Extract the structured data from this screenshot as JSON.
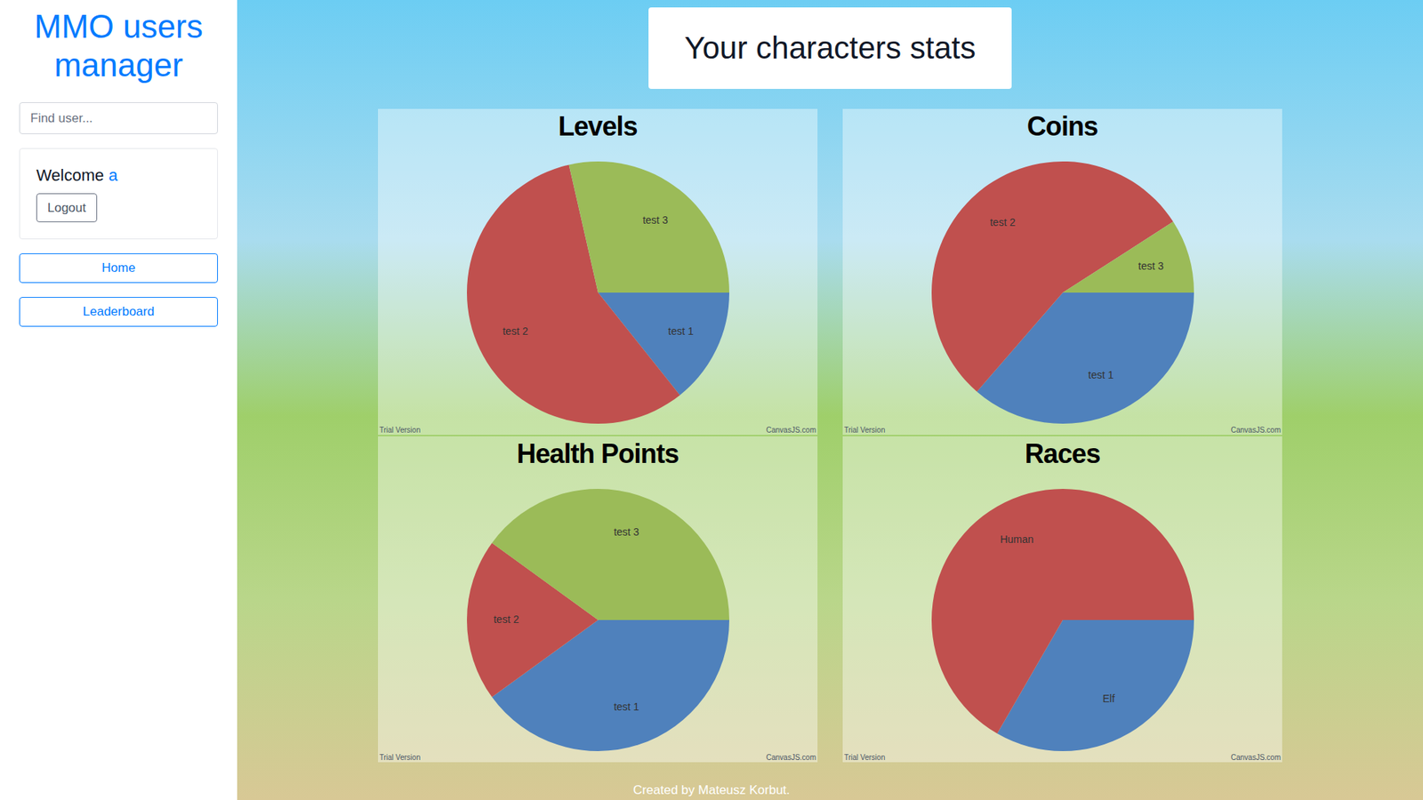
{
  "sidebar": {
    "title": "MMO users manager",
    "search": {
      "placeholder": "Find user..."
    },
    "welcome": {
      "label": "Welcome",
      "user": "a",
      "logout": "Logout"
    },
    "nav": [
      {
        "label": "Home"
      },
      {
        "label": "Leaderboard"
      }
    ]
  },
  "header": {
    "title": "Your characters stats"
  },
  "charts": [
    {
      "title": "Levels",
      "watermark": "Trial Version",
      "credit": "CanvasJS.com",
      "slices": [
        {
          "label": "test 1",
          "value": 5,
          "color": "#4f81bc"
        },
        {
          "label": "test 2",
          "value": 20,
          "color": "#c0504e"
        },
        {
          "label": "test 3",
          "value": 10,
          "color": "#9bbb58"
        }
      ]
    },
    {
      "title": "Coins",
      "watermark": "Trial Version",
      "credit": "CanvasJS.com",
      "slices": [
        {
          "label": "test 1",
          "value": 400,
          "color": "#4f81bc"
        },
        {
          "label": "test 2",
          "value": 600,
          "color": "#c0504e"
        },
        {
          "label": "test 3",
          "value": 100,
          "color": "#9bbb58"
        }
      ]
    },
    {
      "title": "Health Points",
      "watermark": "Trial Version",
      "credit": "CanvasJS.com",
      "slices": [
        {
          "label": "test 1",
          "value": 100,
          "color": "#4f81bc"
        },
        {
          "label": "test 2",
          "value": 50,
          "color": "#c0504e"
        },
        {
          "label": "test 3",
          "value": 100,
          "color": "#9bbb58"
        }
      ]
    },
    {
      "title": "Races",
      "watermark": "Trial Version",
      "credit": "CanvasJS.com",
      "slices": [
        {
          "label": "Elf",
          "value": 1,
          "color": "#4f81bc"
        },
        {
          "label": "Human",
          "value": 2,
          "color": "#c0504e"
        }
      ]
    }
  ],
  "footer": "Created by Mateusz Korbut."
}
